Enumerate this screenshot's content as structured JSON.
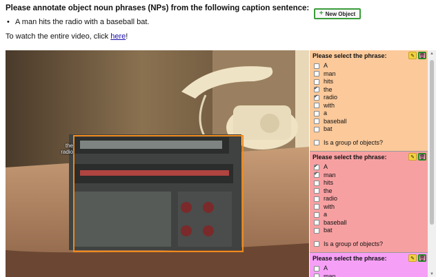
{
  "header": {
    "title": "Please annotate object noun phrases (NPs) from the following caption sentence:",
    "caption": "A man hits the radio with a baseball bat.",
    "watch_prefix": "To watch the entire video, click ",
    "watch_link": "here",
    "watch_suffix": "!"
  },
  "new_object_button": {
    "label": "New Object",
    "icon": "plus-icon"
  },
  "video": {
    "bbox_label_line1": "the",
    "bbox_label_line2": "radio",
    "bbox_color": "#f08a1c"
  },
  "objects": [
    {
      "heading": "Please select the phrase:",
      "background": "#fbc99a",
      "words": [
        {
          "text": "A",
          "checked": false
        },
        {
          "text": "man",
          "checked": false
        },
        {
          "text": "hits",
          "checked": false
        },
        {
          "text": "the",
          "checked": true
        },
        {
          "text": "radio",
          "checked": true
        },
        {
          "text": "with",
          "checked": false
        },
        {
          "text": "a",
          "checked": false
        },
        {
          "text": "baseball",
          "checked": false
        },
        {
          "text": "bat",
          "checked": false
        }
      ],
      "group_label": "Is a group of objects?"
    },
    {
      "heading": "Please select the phrase:",
      "background": "#f7a0a2",
      "words": [
        {
          "text": "A",
          "checked": true
        },
        {
          "text": "man",
          "checked": true
        },
        {
          "text": "hits",
          "checked": false
        },
        {
          "text": "the",
          "checked": false
        },
        {
          "text": "radio",
          "checked": false
        },
        {
          "text": "with",
          "checked": false
        },
        {
          "text": "a",
          "checked": false
        },
        {
          "text": "baseball",
          "checked": false
        },
        {
          "text": "bat",
          "checked": false
        }
      ],
      "group_label": "Is a group of objects?"
    },
    {
      "heading": "Please select the phrase:",
      "background": "#f5a0f6",
      "words": [
        {
          "text": "A",
          "checked": false
        },
        {
          "text": "man",
          "checked": false
        }
      ]
    }
  ],
  "icons": {
    "edit": "edit-icon",
    "delete": "trash-icon"
  }
}
